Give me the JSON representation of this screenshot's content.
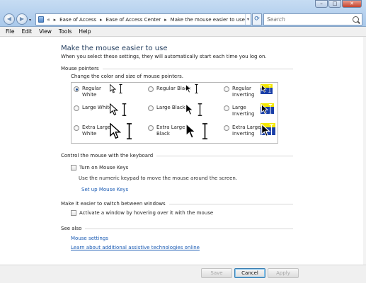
{
  "window": {
    "controls": {
      "minimize": "–",
      "maximize": "□",
      "close": "✕"
    }
  },
  "nav": {
    "back_icon": "back-arrow-icon",
    "forward_icon": "forward-arrow-icon",
    "history_dropdown": "▾"
  },
  "address": {
    "prefix": "«",
    "crumbs": [
      "Ease of Access",
      "Make the mouse easier to use"
    ],
    "crumb_middle": "Ease of Access Center",
    "separator": "▸",
    "dropdown": "▾",
    "refresh": "⟳"
  },
  "search": {
    "placeholder": "Search"
  },
  "menu": [
    "File",
    "Edit",
    "View",
    "Tools",
    "Help"
  ],
  "page": {
    "title": "Make the mouse easier to use",
    "subtitle": "When you select these settings, they will automatically start each time you log on."
  },
  "mouse_pointers": {
    "heading": "Mouse pointers",
    "instruction": "Change the color and size of mouse pointers.",
    "options": [
      {
        "label_line1": "Regular",
        "label_line2": "White",
        "selected": true,
        "scheme": "white",
        "size": "regular"
      },
      {
        "label_line1": "Regular Black",
        "label_line2": "",
        "selected": false,
        "scheme": "black",
        "size": "regular"
      },
      {
        "label_line1": "Regular",
        "label_line2": "Inverting",
        "selected": false,
        "scheme": "inverting",
        "size": "regular"
      },
      {
        "label_line1": "Large White",
        "label_line2": "",
        "selected": false,
        "scheme": "white",
        "size": "large"
      },
      {
        "label_line1": "Large Black",
        "label_line2": "",
        "selected": false,
        "scheme": "black",
        "size": "large"
      },
      {
        "label_line1": "Large",
        "label_line2": "Inverting",
        "selected": false,
        "scheme": "inverting",
        "size": "large"
      },
      {
        "label_line1": "Extra Large",
        "label_line2": "White",
        "selected": false,
        "scheme": "white",
        "size": "xl"
      },
      {
        "label_line1": "Extra Large",
        "label_line2": "Black",
        "selected": false,
        "scheme": "black",
        "size": "xl"
      },
      {
        "label_line1": "Extra Large",
        "label_line2": "Inverting",
        "selected": false,
        "scheme": "inverting",
        "size": "xl"
      }
    ]
  },
  "keyboard_control": {
    "heading": "Control the mouse with the keyboard",
    "checkbox_label": "Turn on Mouse Keys",
    "checked": false,
    "description": "Use the numeric keypad to move the mouse around the screen.",
    "link": "Set up Mouse Keys"
  },
  "window_switching": {
    "heading": "Make it easier to switch between windows",
    "checkbox_label": "Activate a window by hovering over it with the mouse",
    "checked": false
  },
  "see_also": {
    "heading": "See also",
    "links": [
      "Mouse settings",
      "Learn about additional assistive technologies online"
    ]
  },
  "buttons": {
    "save": "Save",
    "cancel": "Cancel",
    "apply": "Apply"
  },
  "colors": {
    "link": "#1a5bb4",
    "title": "#1e395b",
    "inverting_bg": "#1a3fa8",
    "inverting_fill": "#f4e800"
  }
}
